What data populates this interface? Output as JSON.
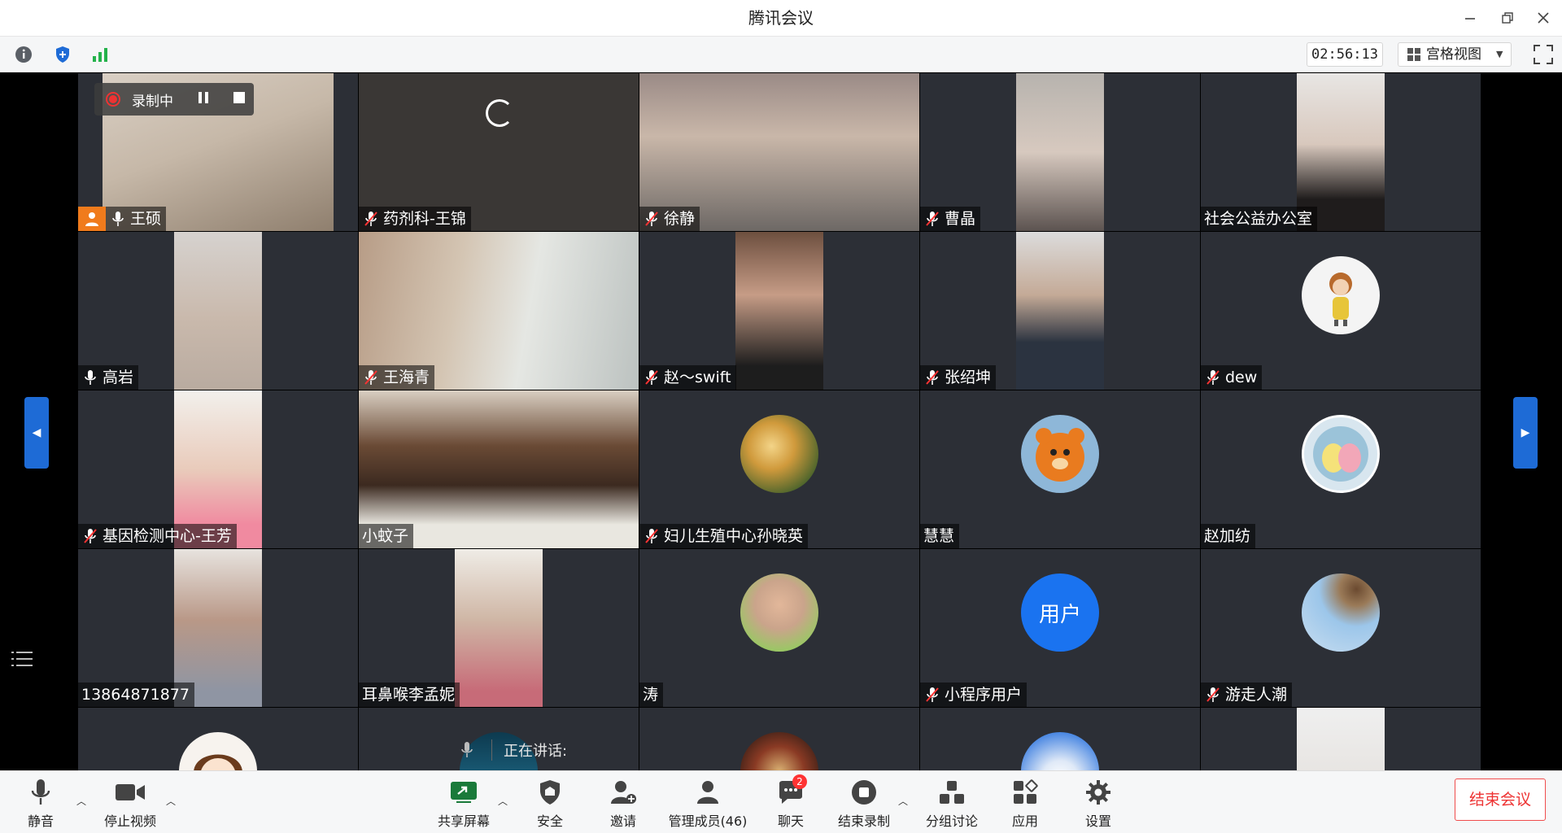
{
  "window": {
    "title": "腾讯会议",
    "minimize_icon": "minimize-icon",
    "restore_icon": "restore-icon",
    "close_icon": "close-icon"
  },
  "toolbar": {
    "timer": "02:56:13",
    "view_label": "宫格视图",
    "info_icon": "info-icon",
    "security_icon": "shield-plus-icon",
    "signal_icon": "signal-bars-icon"
  },
  "recording": {
    "label": "录制中"
  },
  "tiles": [
    {
      "name": "王硕",
      "mic": "on",
      "host_badge": true
    },
    {
      "name": "药剂科-王锦",
      "mic": "muted",
      "loading": true
    },
    {
      "name": "徐静",
      "mic": "muted"
    },
    {
      "name": "曹晶",
      "mic": "muted"
    },
    {
      "name": "社会公益办公室",
      "mic": "none"
    },
    {
      "name": "高岩",
      "mic": "on"
    },
    {
      "name": "王海青",
      "mic": "muted"
    },
    {
      "name": "赵～swift",
      "mic": "muted"
    },
    {
      "name": "张绍坤",
      "mic": "muted"
    },
    {
      "name": "dew",
      "mic": "muted"
    },
    {
      "name": "基因检测中心-王芳",
      "mic": "muted"
    },
    {
      "name": "小蚊子",
      "mic": "none"
    },
    {
      "name": "妇儿生殖中心孙晓英",
      "mic": "muted"
    },
    {
      "name": "慧慧",
      "mic": "none"
    },
    {
      "name": "赵加纺",
      "mic": "none"
    },
    {
      "name": "13864871877",
      "mic": "none"
    },
    {
      "name": "耳鼻喉李孟妮",
      "mic": "none"
    },
    {
      "name": "涛",
      "mic": "none"
    },
    {
      "name": "小程序用户",
      "mic": "muted",
      "avatar_text": "用户"
    },
    {
      "name": "游走人潮",
      "mic": "muted"
    }
  ],
  "speaking": {
    "label": "正在讲话:"
  },
  "bottombar": {
    "mute": "静音",
    "stop_video": "停止视频",
    "share": "共享屏幕",
    "security": "安全",
    "invite": "邀请",
    "members": "管理成员(46)",
    "chat": "聊天",
    "chat_badge": "2",
    "end_record": "结束录制",
    "breakout": "分组讨论",
    "apps": "应用",
    "settings": "设置",
    "end_meeting": "结束会议"
  }
}
